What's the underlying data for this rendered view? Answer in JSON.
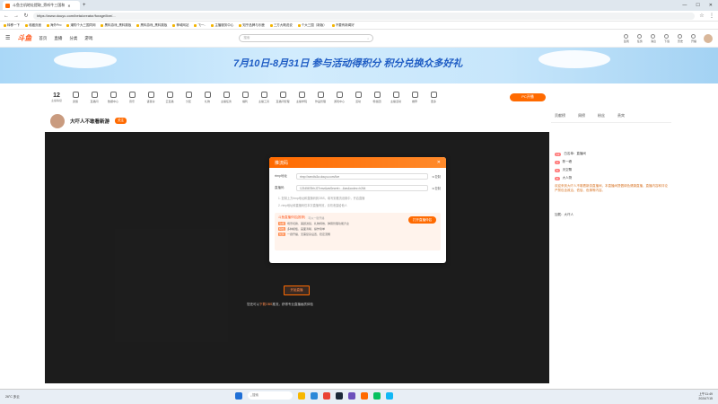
{
  "browser": {
    "tab_title": "斗鱼主机地址提取_旁听牛三国和",
    "url": "https://www.douyu.com/beta/creator/forage/live/...",
    "bookmarks": [
      "转移一下",
      "收藏页面",
      "海外Pro",
      "潮购个大三国同网",
      "黑料游戏_黑料跳板",
      "黑料游戏_黑料跳板",
      "神域网站",
      "飞一..",
      "主播服务中心",
      "知乎品牌与乐鹿",
      "三方大概说说",
      "个大三国（新版）",
      "不要有新闻好"
    ]
  },
  "site": {
    "logo": "斗鱼",
    "nav": [
      "首页",
      "直播",
      "分类",
      "游戏"
    ],
    "search_placeholder": "搜索",
    "header_icons": [
      "签到",
      "任务",
      "消息",
      "下载",
      "历史",
      "开播"
    ]
  },
  "banner": {
    "text": "7月10日-8月31日 参与活动得积分 积分兑换众多好礼"
  },
  "toolbar": {
    "level": "12",
    "level_label": "主播等级",
    "tools": [
      "贵族",
      "直播间",
      "数据中心",
      "音乐",
      "语音房",
      "云直播",
      "分区",
      "礼物",
      "主播任务",
      "福利",
      "主播工具",
      "直播间管理",
      "主播学院",
      "作品管理",
      "游戏中心",
      "活动",
      "粉丝团",
      "主播活动",
      "推荐",
      "更多"
    ],
    "pc_button": "PC开播"
  },
  "room": {
    "title": "大吓人不敢看新游",
    "follow": "关注"
  },
  "sidebar": {
    "tabs": [
      "贡献榜",
      "周榜",
      "粉丝",
      "贵宾"
    ],
    "chat": [
      {
        "tag": "12",
        "text": "白名单：直播间"
      },
      {
        "tag": "3",
        "text": "陈一峰"
      },
      {
        "tag": "5",
        "text": "天空飘"
      },
      {
        "tag": "8",
        "text": "大人物"
      }
    ],
    "notice": "欢迎来到大吓人不敢看新游直播间，本直播间提倡绿色健康直播，直播内容和评论严禁包含政治、低俗、色情等内容。",
    "bottom_user": "加载：大吓人"
  },
  "modal": {
    "title": "推流码",
    "rtmp_label": "rtmp地址",
    "rtmp_value": "rtmp://sendtc3a.douyu.com/live",
    "code_label": "直播码",
    "code_value": "12345678rhJ27vmz&wsSecret=...&ws&codec=h264",
    "copy": "复制",
    "note1": "1. 复制上方rtmp地址和直播码到OBS，填写到推流设置中，开启直播",
    "note2": "2. rtmp地址和直播码仅本次直播有效，请勿泄露给他人",
    "tip_title": "斗鱼直播伴侣(推荐)",
    "tip_tag": "可以一键开播",
    "tip_lines": [
      {
        "badge": "功能",
        "text": "场景切换、美颜滤镜、礼物特效、弹幕管理功能齐全"
      },
      {
        "badge": "特色",
        "text": "多种模板、画面清晰、操作简单"
      },
      {
        "badge": "优势",
        "text": "一键开播、无需复杂设置、稳定流畅"
      }
    ],
    "tip_button": "打开直播伴侣"
  },
  "video": {
    "start_button": "开始直播",
    "obs_hint_pre": "您还可以",
    "obs_hint_link": "下载OBS",
    "obs_hint_post": "推流，获得专业直播画质体验"
  },
  "taskbar": {
    "weather": "26°C 多云",
    "search": "搜索",
    "time": "上午11:49",
    "date": "2024/7/15"
  }
}
